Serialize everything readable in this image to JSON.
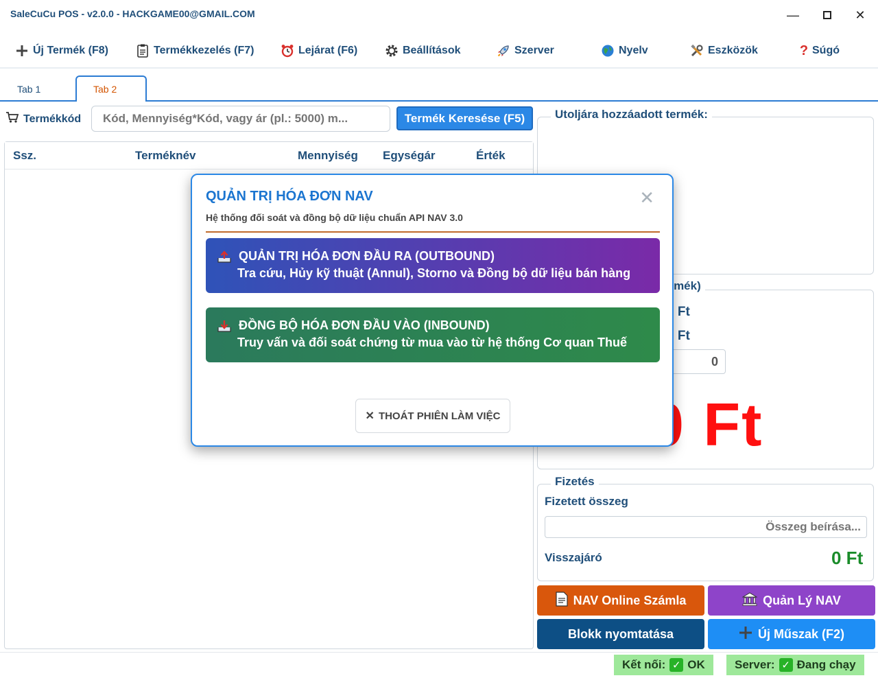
{
  "window": {
    "title": "SaleCuCu POS - v2.0.0 - HACKGAME00@GMAIL.COM",
    "minimize": "—",
    "maximize": "☐",
    "close": "✕"
  },
  "menu": [
    {
      "label": "Új Termék (F8)",
      "icon": "plus-icon"
    },
    {
      "label": "Termékkezelés (F7)",
      "icon": "clipboard-icon"
    },
    {
      "label": "Lejárat (F6)",
      "icon": "alarm-clock-icon"
    },
    {
      "label": "Beállítások",
      "icon": "gear-icon"
    },
    {
      "label": "Szerver",
      "icon": "rocket-icon"
    },
    {
      "label": "Nyelv",
      "icon": "globe-icon"
    },
    {
      "label": "Eszközök",
      "icon": "tools-icon"
    },
    {
      "label": "Súgó",
      "icon": "question-icon"
    }
  ],
  "tabs": [
    {
      "label": "Tab 1",
      "active": false
    },
    {
      "label": "Tab 2",
      "active": true
    }
  ],
  "search": {
    "label": "Termékkód",
    "placeholder": "Kód, Mennyiség*Kód, vagy ár (pl.: 5000) m...",
    "button": "Termék Keresése (F5)"
  },
  "table": {
    "columns": [
      "Ssz.",
      "Terméknév",
      "Mennyiség",
      "Egységár",
      "Érték"
    ]
  },
  "right": {
    "last_added_title": "Utoljára hozzáadott termék:",
    "summary_legend_partial": "ermék)",
    "row1_value": "0 Ft",
    "row2_value": "0 Ft",
    "qty_value": "0",
    "total": "0 Ft"
  },
  "payment": {
    "legend": "Fizetés",
    "paid_label": "Fizetett összeg",
    "paid_placeholder": "Összeg beírása...",
    "change_label": "Visszajáró",
    "change_value": "0 Ft"
  },
  "actions": {
    "nav_online": "NAV Online Számla",
    "nav_manage": "Quản Lý NAV",
    "print": "Blokk nyomtatása",
    "new_shift": "Új Műszak (F2)"
  },
  "status": {
    "connection_label": "Kết nối:",
    "connection_value": "OK",
    "server_label": "Server:",
    "server_value": "Đang chạy"
  },
  "modal": {
    "title": "QUẢN TRỊ HÓA ĐƠN NAV",
    "subtitle": "Hệ thống đối soát và đồng bộ dữ liệu chuẩn API NAV 3.0",
    "close": "✕",
    "outbound_title": "QUẢN TRỊ HÓA ĐƠN ĐẦU RA (OUTBOUND)",
    "outbound_desc": "Tra cứu, Hủy kỹ thuật (Annul), Storno và Đồng bộ dữ liệu bán hàng",
    "inbound_title": "ĐỒNG BỘ HÓA ĐƠN ĐẦU VÀO (INBOUND)",
    "inbound_desc": "Truy vấn và đối soát chứng từ mua vào từ hệ thống Cơ quan Thuế",
    "exit_button": "THOÁT PHIÊN LÀM VIỆC",
    "colors": {
      "outbound_from": "#2f53b8",
      "outbound_to": "#7a2aa8",
      "inbound_from": "#2b7a5c",
      "inbound_to": "#2e8a4a"
    }
  }
}
